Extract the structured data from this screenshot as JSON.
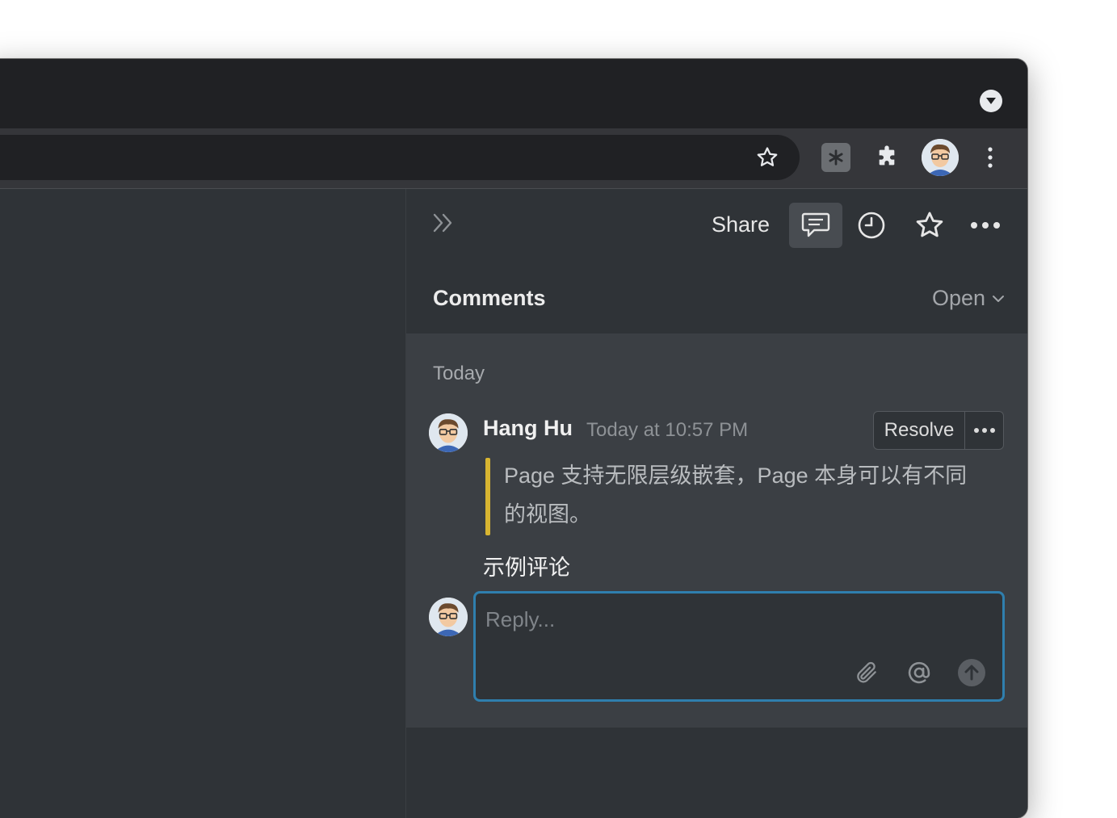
{
  "browser": {
    "tab_dropdown_icon": "chevron-down-circle-icon",
    "toolbar_icons": [
      "bookmark-star-icon",
      "extension-asterisk-icon",
      "extensions-puzzle-icon",
      "profile-avatar",
      "kebab-menu-icon"
    ]
  },
  "panel": {
    "collapse_icon": "double-chevron-right-icon",
    "share_label": "Share",
    "header_icons": [
      "comment-icon",
      "clock-icon",
      "star-icon",
      "more-horizontal-icon"
    ],
    "title": "Comments",
    "filter_label": "Open"
  },
  "thread": {
    "group_label": "Today",
    "comment": {
      "author": "Hang Hu",
      "timestamp": "Today at 10:57 PM",
      "resolve_label": "Resolve",
      "quote": "Page 支持无限层级嵌套，Page 本身可以有不同的视图。",
      "body": "示例评论"
    },
    "reply": {
      "placeholder": "Reply...",
      "tools": [
        "paperclip-icon",
        "at-mention-icon",
        "send-arrow-icon"
      ]
    }
  },
  "colors": {
    "accent_focus": "#2f7fae",
    "quote_bar": "#d8b531",
    "panel_bg": "#2f3337",
    "thread_bg": "#3b3f44"
  }
}
